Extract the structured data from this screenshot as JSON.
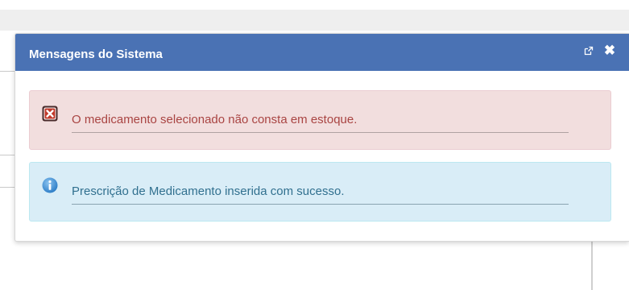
{
  "dialog": {
    "title": "Mensagens do Sistema",
    "popout_icon": "external-link-icon",
    "close_icon": "close-icon",
    "close_glyph": "✖",
    "header_color": "#4a72b4"
  },
  "messages": [
    {
      "type": "error",
      "icon": "error-icon",
      "text": "O medicamento selecionado não consta em estoque.",
      "bg_color": "#f2dede",
      "text_color": "#a94442"
    },
    {
      "type": "info",
      "icon": "info-icon",
      "text": "Prescrição de Medicamento inserida com sucesso.",
      "bg_color": "#d9edf7",
      "text_color": "#31708f"
    }
  ]
}
